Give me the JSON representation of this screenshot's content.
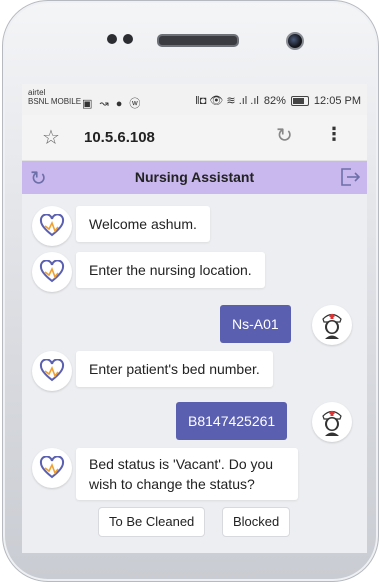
{
  "status_bar": {
    "carrier_line1": "airtel",
    "carrier_line2": "BSNL MOBILE",
    "left_icons": "▣ ↝ ● ⓦ",
    "right_icons": "ǁ◘ 👁 ≋ .ıl .ıl",
    "battery": "82%",
    "time": "12:05 PM"
  },
  "browser": {
    "url": "10.5.6.108",
    "icons": [
      "star-icon",
      "refresh-icon",
      "more-vertical-icon"
    ]
  },
  "app": {
    "title": "Nursing Assistant",
    "accent_color": "#c9b8ee",
    "bubble_color": "#5a5fb0"
  },
  "messages": [
    {
      "from": "bot",
      "text": "Welcome ashum."
    },
    {
      "from": "bot",
      "text": "Enter the nursing location."
    },
    {
      "from": "user",
      "text": "Ns-A01"
    },
    {
      "from": "bot",
      "text": "Enter patient's bed number."
    },
    {
      "from": "user",
      "text": "B8147425261"
    },
    {
      "from": "bot",
      "text": "Bed status is 'Vacant'. Do you wish to change the status?"
    }
  ],
  "quick_replies": [
    "To Be Cleaned",
    "Blocked"
  ]
}
